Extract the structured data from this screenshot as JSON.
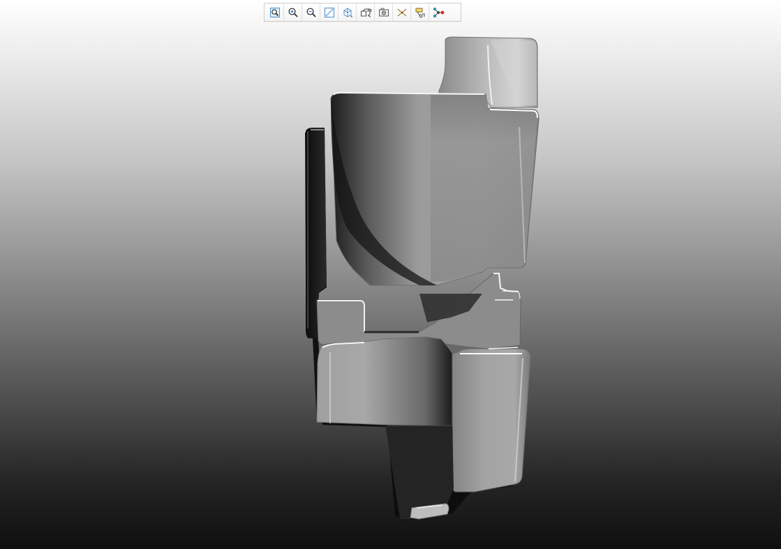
{
  "viewer": {
    "toolbar": {
      "items": [
        {
          "icon": "zoom-window-icon"
        },
        {
          "icon": "zoom-in-icon"
        },
        {
          "icon": "zoom-out-icon"
        },
        {
          "icon": "sketch-view-icon"
        },
        {
          "icon": "display-style-icon"
        },
        {
          "icon": "annotation-view-icon"
        },
        {
          "icon": "camera-icon"
        },
        {
          "icon": "datum-plane-icon"
        },
        {
          "icon": "saved-view-icon"
        },
        {
          "icon": "network-icon"
        }
      ]
    },
    "colors": {
      "background_top": "#ffffff",
      "background_bottom": "#0f0f0f",
      "model_light": "#d9d9d9",
      "model_mid": "#9a9a9a",
      "model_dark": "#1e1e1e",
      "accent_teal": "#2a9aa7",
      "accent_red": "#d62828"
    }
  }
}
